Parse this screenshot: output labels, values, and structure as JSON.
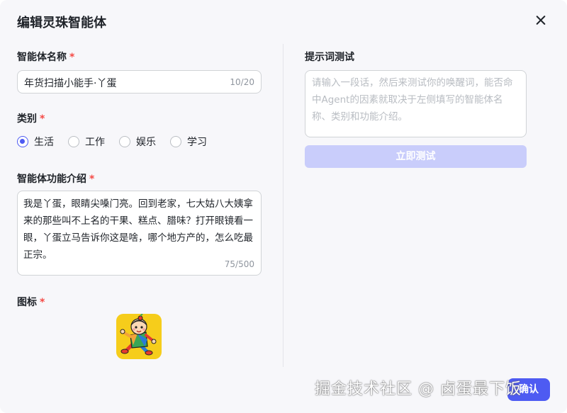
{
  "dialog": {
    "title": "编辑灵珠智能体",
    "close_icon": "close-icon"
  },
  "name_field": {
    "label": "智能体名称",
    "required_mark": "*",
    "value": "年货扫描小能手·丫蛋",
    "counter": "10/20"
  },
  "category": {
    "label": "类别",
    "required_mark": "*",
    "selected": "生活",
    "options": [
      "生活",
      "工作",
      "娱乐",
      "学习"
    ]
  },
  "description_field": {
    "label": "智能体功能介绍",
    "required_mark": "*",
    "value": "我是丫蛋，眼睛尖嗓门亮。回到老家，七大姑八大姨拿来的那些叫不上名的干果、糕点、腊味？打开眼镜看一眼，丫蛋立马告诉你这是啥，哪个地方产的，怎么吃最正宗。",
    "counter": "75/500"
  },
  "icon_field": {
    "label": "图标",
    "required_mark": "*",
    "icon_name": "agent-avatar-icon"
  },
  "prompt_test": {
    "label": "提示词测试",
    "placeholder": "请输入一段话，然后来测试你的唤醒词，能否命中Agent的因素就取决于左侧填写的智能体名称、类别和功能介绍。",
    "button_label": "立即测试"
  },
  "footer": {
    "confirm_label": "确认",
    "watermark": "掘金技术社区 @ 卤蛋最下饭"
  },
  "colors": {
    "accent": "#4e5bf2",
    "required": "#f54a45",
    "disabled_button": "#c9cdfb",
    "icon_bg": "#f6cd1b"
  }
}
